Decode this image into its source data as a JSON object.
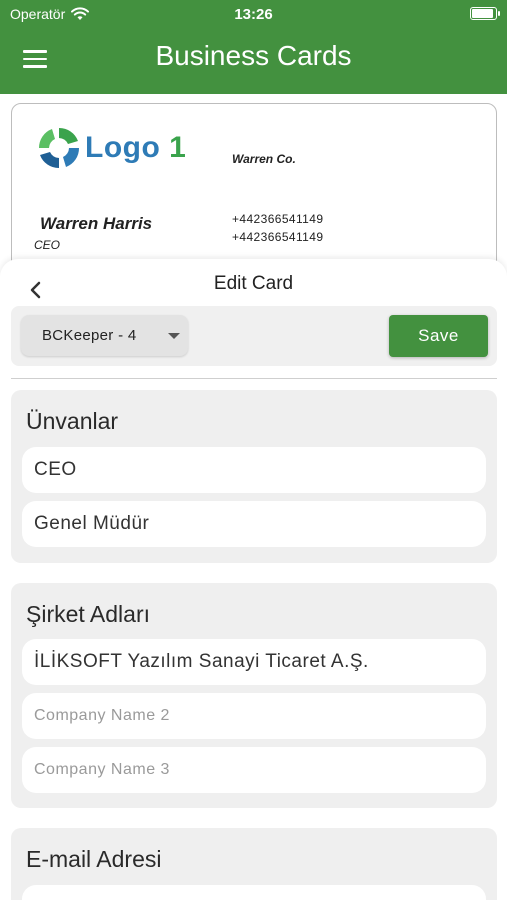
{
  "status": {
    "carrier": "Operatör",
    "time": "13:26"
  },
  "appbar": {
    "title": "Business Cards"
  },
  "card": {
    "logo_text": "Logo",
    "logo_number": "1",
    "company": "Warren Co.",
    "name": "Warren Harris",
    "title": "CEO",
    "phones": [
      "+442366541149",
      "+442366541149"
    ]
  },
  "sheet": {
    "title": "Edit Card",
    "dropdown_value": "BCKeeper - 4",
    "save_label": "Save"
  },
  "sections": {
    "titles": {
      "heading": "Ünvanlar",
      "values": [
        "CEO",
        "Genel Müdür"
      ]
    },
    "companies": {
      "heading": "Şirket Adları",
      "value": "İLİKSOFT Yazılım Sanayi Ticaret A.Ş.",
      "placeholders": [
        "Company Name 2",
        "Company Name 3"
      ]
    },
    "email": {
      "heading": "E-mail Adresi"
    }
  },
  "colors": {
    "primary": "#43913f",
    "logo_blue": "#2e7bb6",
    "logo_green": "#3aa34c"
  }
}
